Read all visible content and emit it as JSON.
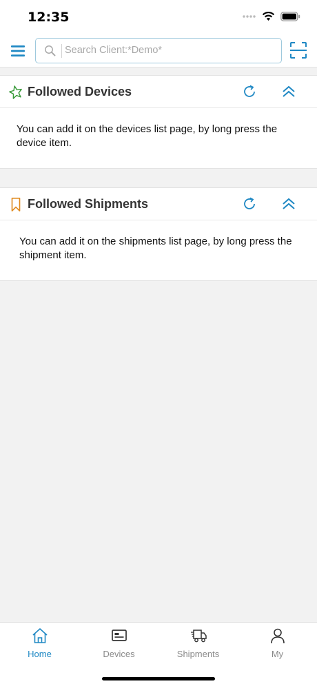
{
  "status_bar": {
    "time": "12:35"
  },
  "header": {
    "menu_icon": "hamburger-menu-icon",
    "search": {
      "placeholder": "Search Client:*Demo*",
      "value": ""
    },
    "scan_icon": "scan-icon"
  },
  "sections": [
    {
      "title": "Followed Devices",
      "icon": "star-outline-icon",
      "icon_color": "#3a9a3a",
      "message": "You can add it on the devices list page, by long press the device item."
    },
    {
      "title": "Followed Shipments",
      "icon": "bookmark-outline-icon",
      "icon_color": "#e08a1e",
      "message": "You can add it on the shipments list page, by long press the shipment item."
    }
  ],
  "tabs": [
    {
      "label": "Home",
      "icon": "home-icon",
      "active": true
    },
    {
      "label": "Devices",
      "icon": "device-card-icon",
      "active": false
    },
    {
      "label": "Shipments",
      "icon": "truck-icon",
      "active": false
    },
    {
      "label": "My",
      "icon": "person-icon",
      "active": false
    }
  ],
  "colors": {
    "accent": "#1f88c4",
    "background": "#f2f2f2",
    "inactive_tab": "#8a8a8a"
  }
}
